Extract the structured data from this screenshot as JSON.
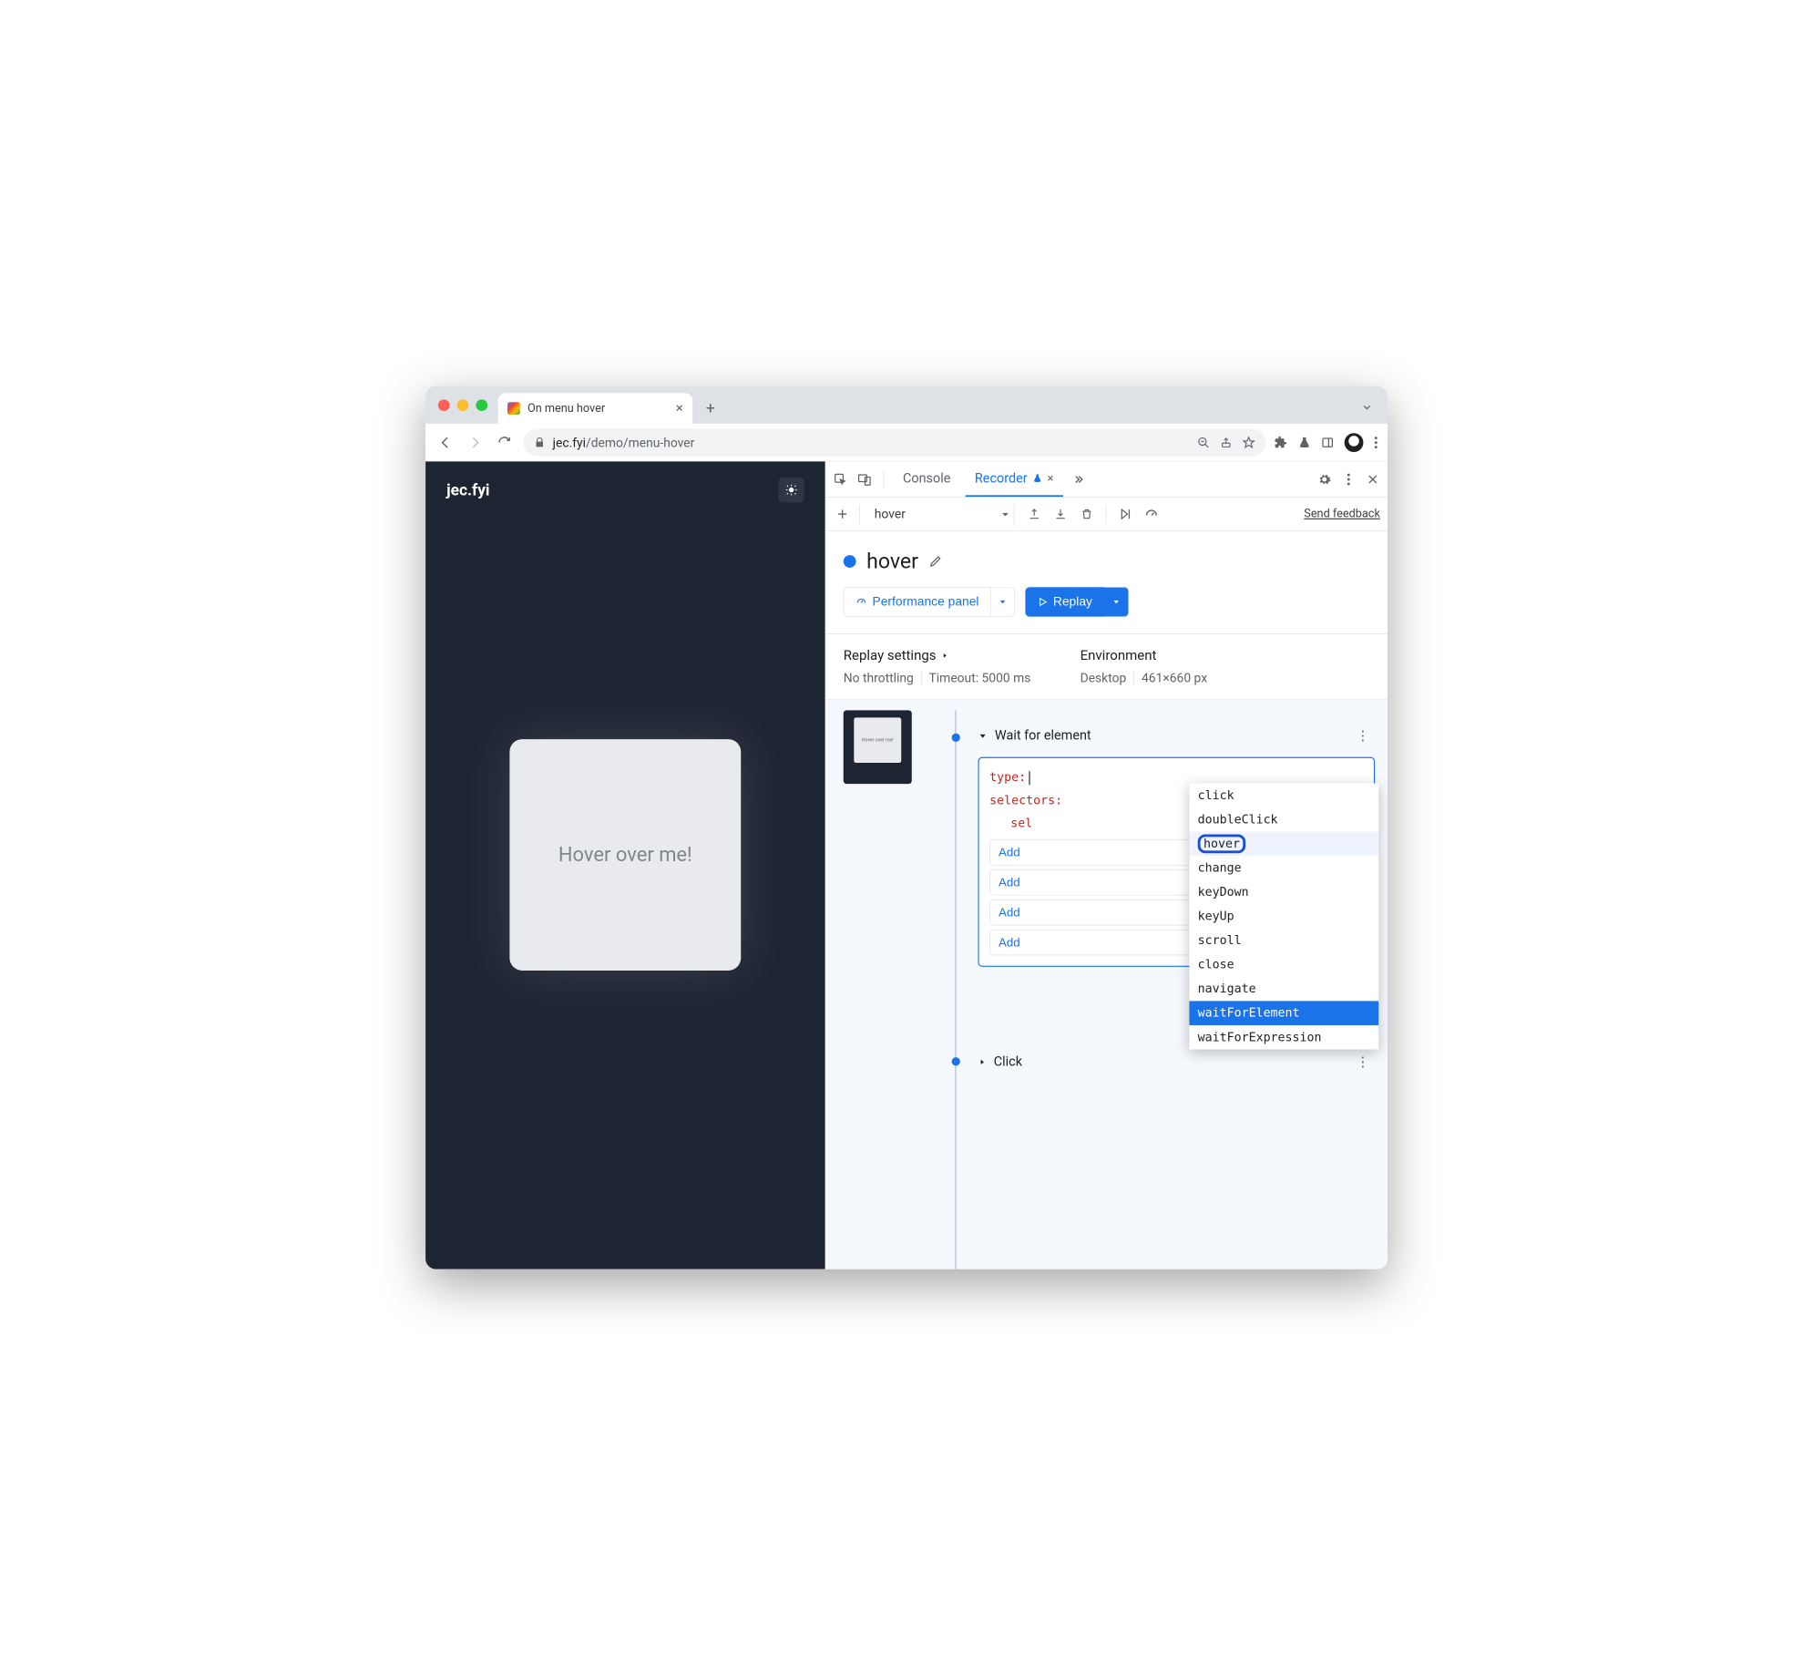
{
  "tab": {
    "title": "On menu hover"
  },
  "url": {
    "host": "jec.fyi",
    "path": "/demo/menu-hover"
  },
  "page": {
    "logo": "jec.fyi",
    "hover_text": "Hover over me!"
  },
  "devtools": {
    "tabs": {
      "console": "Console",
      "recorder": "Recorder"
    },
    "recording_selector": "hover",
    "feedback": "Send feedback",
    "recording_name": "hover",
    "perf_button": "Performance panel",
    "replay_button": "Replay",
    "replay_settings_label": "Replay settings",
    "no_throttling": "No throttling",
    "timeout": "Timeout: 5000 ms",
    "environment_label": "Environment",
    "env_device": "Desktop",
    "env_size": "461×660 px"
  },
  "step": {
    "title": "Wait for element",
    "type_key": "type:",
    "selectors_key": "selectors:",
    "sel_truncated": "sel",
    "thumb_text": "Hover over me!",
    "add_buttons": [
      "Add ",
      "Add ",
      "Add ",
      "Add "
    ]
  },
  "next_step": {
    "title": "Click"
  },
  "autocomplete": {
    "options": [
      "click",
      "doubleClick",
      "hover",
      "change",
      "keyDown",
      "keyUp",
      "scroll",
      "close",
      "navigate",
      "waitForElement",
      "waitForExpression"
    ],
    "highlighted": "hover",
    "selected": "waitForElement"
  }
}
